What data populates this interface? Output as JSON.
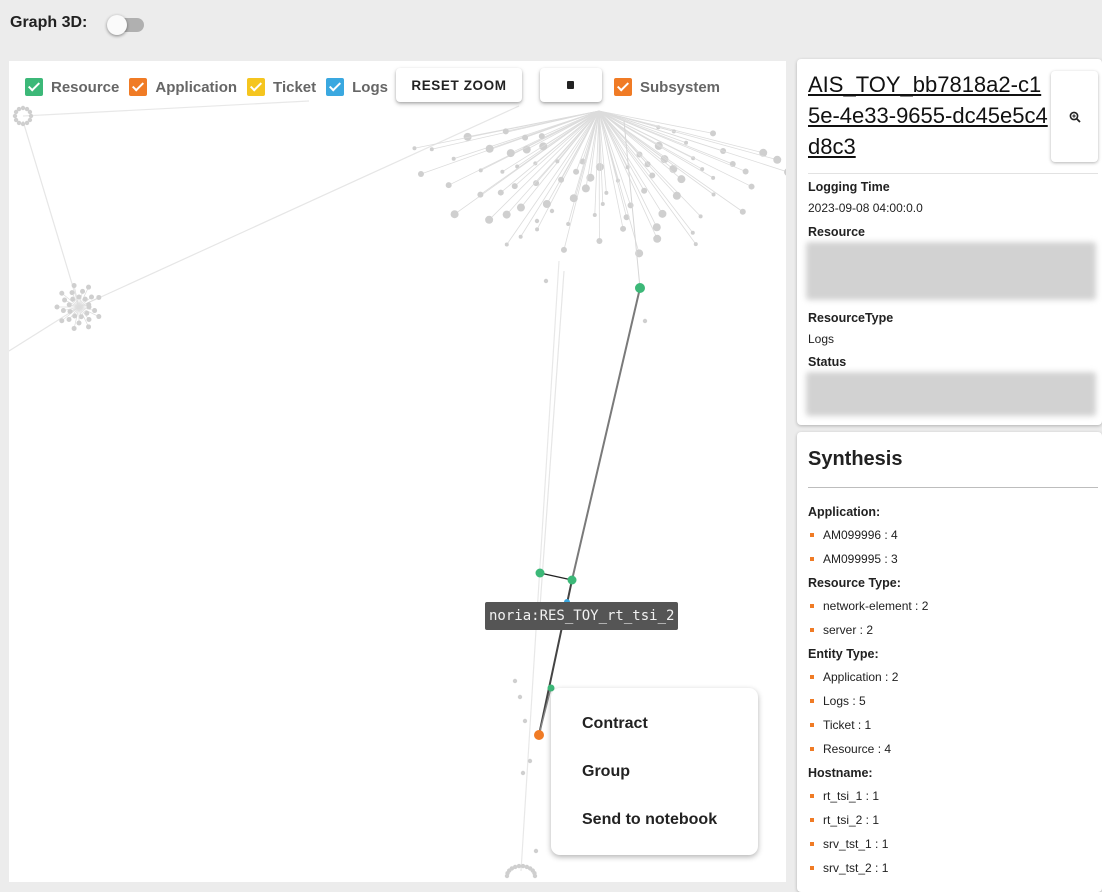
{
  "header": {
    "graph3d_label": "Graph 3D:",
    "graph3d_enabled": false
  },
  "legend": {
    "items": [
      {
        "label": "Resource",
        "color": "#3cb878",
        "checked": true
      },
      {
        "label": "Application",
        "color": "#f07b25",
        "checked": true
      },
      {
        "label": "Ticket",
        "color": "#f5c51f",
        "checked": true
      },
      {
        "label": "Logs",
        "color": "#3aa8e0",
        "checked": true
      }
    ],
    "reset_zoom_label": "RESET ZOOM",
    "subsystem": {
      "label": "Subsystem",
      "color": "#f07b25",
      "checked": true
    }
  },
  "graph": {
    "tooltip": "noria:RES_TOY_rt_tsi_2"
  },
  "context_menu": {
    "items": [
      "Contract",
      "Group",
      "Send to notebook"
    ]
  },
  "details": {
    "title": "AIS_TOY_bb7818a2-c15e-4e33-9655-dc45e5c4d8c3",
    "logging_time_label": "Logging Time",
    "logging_time": "2023-09-08 04:00:0.0",
    "resource_label": "Resource",
    "resource_type_label": "ResourceType",
    "resource_type": "Logs",
    "status_label": "Status"
  },
  "synthesis": {
    "title": "Synthesis",
    "sections": [
      {
        "title": "Application:",
        "items": [
          "AM099996 : 4",
          "AM099995 : 3"
        ]
      },
      {
        "title": "Resource Type:",
        "items": [
          "network-element : 2",
          "server : 2"
        ]
      },
      {
        "title": "Entity Type:",
        "items": [
          "Application : 2",
          "Logs : 5",
          "Ticket : 1",
          "Resource : 4"
        ]
      },
      {
        "title": "Hostname:",
        "items": [
          "rt_tsi_1 : 1",
          "rt_tsi_2 : 1",
          "srv_tst_1 : 1",
          "srv_tst_2 : 1"
        ]
      }
    ]
  }
}
